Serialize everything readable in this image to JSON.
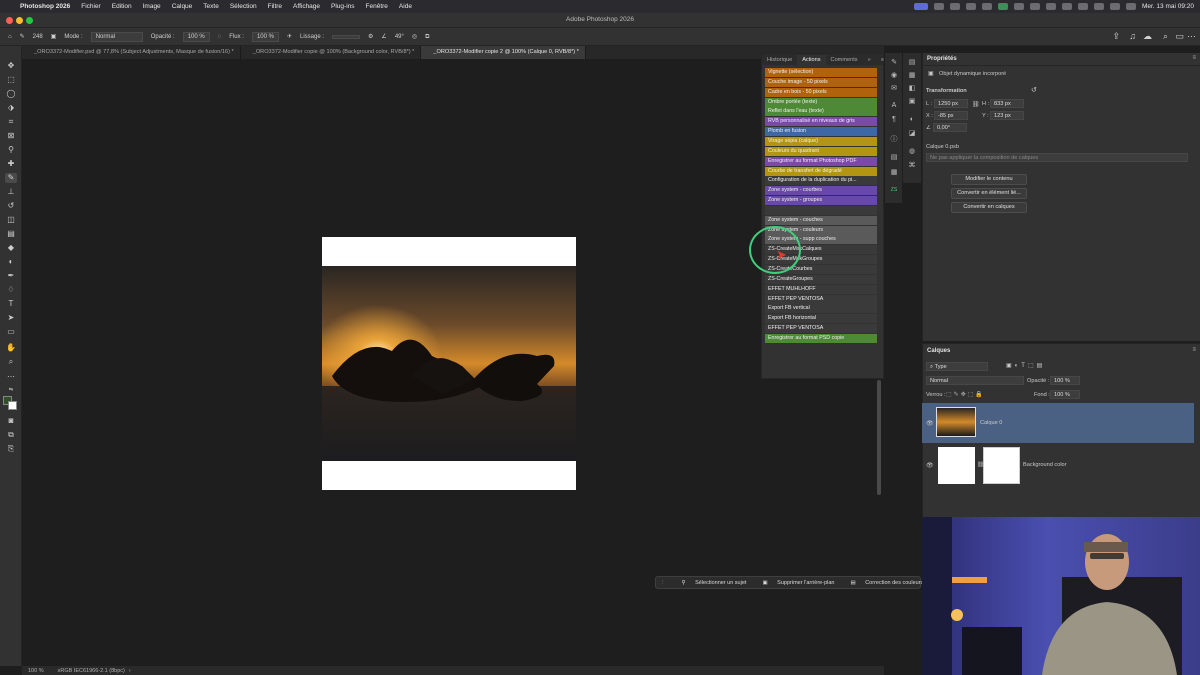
{
  "menubar": {
    "app": "Photoshop 2026",
    "items": [
      "Fichier",
      "Edition",
      "Image",
      "Calque",
      "Texte",
      "Sélection",
      "Filtre",
      "Affichage",
      "Plug-ins",
      "Fenêtre",
      "Aide"
    ],
    "clock": "Mer. 13 mai 09:20"
  },
  "window": {
    "title": "Adobe Photoshop 2026"
  },
  "options": {
    "brush_size": "248",
    "mode_label": "Mode :",
    "mode_value": "Normal",
    "opacity_label": "Opacité :",
    "opacity_value": "100 %",
    "flow_label": "Flux :",
    "flow_value": "100 %",
    "smoothing_label": "Lissage :",
    "angle_value": "49°"
  },
  "tabs": [
    {
      "label": "_ORO3372-Modifier.psd @ 77,8% (Subject Adjustments, Masque de fusion/16) *"
    },
    {
      "label": "_ORO3372-Modifier copie @ 100% (Background color, RVB/8*) *"
    },
    {
      "label": "_ORO3372-Modifier copie 2 @ 100% (Calque 0, RVB/8*) *"
    }
  ],
  "status": {
    "zoom": "100 %",
    "profile": "sRGB IEC61966-2.1 (8bpc)"
  },
  "actions_panel": {
    "tabs": [
      "Historique",
      "Actions",
      "Comments"
    ],
    "items": [
      {
        "label": "Vignette (sélection)",
        "color": "#b0630c"
      },
      {
        "label": "Couche image - 50 pixels",
        "color": "#b0630c"
      },
      {
        "label": "Cadre en bois - 50 pixels",
        "color": "#b0630c"
      },
      {
        "label": "Ombre portée (texte)",
        "color": "#4e8a35"
      },
      {
        "label": "Reflet dans l'eau (texte)",
        "color": "#4e8a35"
      },
      {
        "label": "RVB personnalisé en niveaux de gris",
        "color": "#7a4aa8"
      },
      {
        "label": "Plomb en fusion",
        "color": "#3e67a6"
      },
      {
        "label": "Virage sépia (calque)",
        "color": "#b49512"
      },
      {
        "label": "Couleurs du quadrant",
        "color": "#b49512"
      },
      {
        "label": "Enregistrer au format Photoshop PDF",
        "color": "#7a4aa8"
      },
      {
        "label": "Courbe de transfert de dégradé",
        "color": "#b49512"
      },
      {
        "label": "Configuration de la duplication du pi...",
        "color": "#3a3a3a"
      },
      {
        "label": "Zone system - courbes",
        "color": "#6848a8"
      },
      {
        "label": "Zone system - groupes",
        "color": "#6848a8"
      },
      {
        "label": "",
        "color": "#3a3a3a"
      },
      {
        "label": "Zone system - couches",
        "color": "#5a5a5a"
      },
      {
        "label": "Zone system - couleurs",
        "color": "#5a5a5a"
      },
      {
        "label": "Zone system - supp couches",
        "color": "#5a5a5a"
      },
      {
        "label": "ZS-CreateMskCalques",
        "color": "#3a3a3a"
      },
      {
        "label": "ZS-CreateMskGroupes",
        "color": "#3a3a3a"
      },
      {
        "label": "ZS-CreateCourbes",
        "color": "#3a3a3a"
      },
      {
        "label": "ZS-CreateGroupes",
        "color": "#3a3a3a"
      },
      {
        "label": "EFFET MUHLHOFF",
        "color": "#3a3a3a"
      },
      {
        "label": "EFFET PEP VENTOSA",
        "color": "#3a3a3a"
      },
      {
        "label": "Export FB vertical",
        "color": "#3a3a3a"
      },
      {
        "label": "Export FB horizontal",
        "color": "#3a3a3a"
      },
      {
        "label": "EFFET PEP VENTOSA",
        "color": "#3a3a3a"
      },
      {
        "label": "Enregistrer au format PSD copie",
        "color": "#4e8a35"
      }
    ]
  },
  "properties": {
    "title": "Propriétés",
    "object_type": "Objet dynamique incorporé",
    "transform_title": "Transformation",
    "w_label": "L :",
    "w_value": "1250 px",
    "h_label": "H :",
    "h_value": "833 px",
    "x_label": "X :",
    "x_value": "-85 px",
    "y_label": "Y :",
    "y_value": "123 px",
    "angle_value": "0,00°",
    "file_name": "Calque 0.psb",
    "comp_placeholder": "Ne pas appliquer la composition de calques",
    "buttons": [
      "Modifier le contenu",
      "Convertir en élément lié...",
      "Convertir en calques"
    ]
  },
  "layers": {
    "title": "Calques",
    "filter": "Type",
    "blend": "Normal",
    "opacity_label": "Opacité :",
    "opacity_value": "100 %",
    "lock_label": "Verrou :",
    "fill_label": "Fond :",
    "fill_value": "100 %",
    "items": [
      {
        "name": "Calque 0",
        "selected": true
      },
      {
        "name": "Background color",
        "selected": false
      }
    ]
  },
  "context_bar": [
    "Sélectionner un sujet",
    "Supprimer l'arrière-plan",
    "Correction des couleurs"
  ],
  "colors": {
    "accent_select": "#4a6183",
    "cursor_ring": "#3ecf7a"
  }
}
